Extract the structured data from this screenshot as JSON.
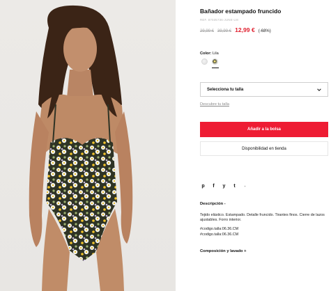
{
  "product": {
    "title": "Bañador estampado fruncido",
    "reference": "REF. 87035736-JUNE-LM",
    "old_price_1": "29,99 €",
    "old_price_2": "39,99 €",
    "sale_price": "12,99 €",
    "discount": "(-68%)",
    "sale_color": "#e0202f"
  },
  "color": {
    "label": "Color:",
    "value": "Lila",
    "swatches": [
      "white",
      "print"
    ]
  },
  "size_select": {
    "label": "Selecciona tu talla",
    "icon": "chevron-down-icon"
  },
  "size_guide_link": "Descubre tu talla",
  "buttons": {
    "add_to_bag": "Añadir a la bolsa",
    "add_to_bag_color": "#ee1c33",
    "store_availability": "Disponibilidad en tienda"
  },
  "share_icons": [
    "pinterest-icon",
    "facebook-icon",
    "twitter-icon",
    "tumblr-icon",
    "plus-icon"
  ],
  "share_glyphs": {
    "pinterest": "p",
    "facebook": "f",
    "twitter": "y",
    "tumblr": "t",
    "plus": "+"
  },
  "description": {
    "heading": "Descripción -",
    "text": "Tejido elástico. Estampado. Detalle fruncido. Tirantes finos. Cierre de lazos ajustables. Forro interior.",
    "code_1": "#codigo.talla:06.36.CM",
    "code_2": "#codigo.talla:06.36.CM"
  },
  "composition": {
    "heading": "Composición y lavado +"
  }
}
